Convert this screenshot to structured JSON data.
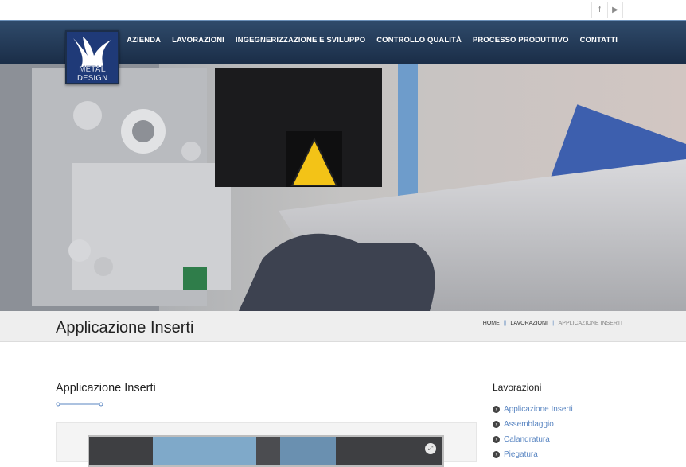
{
  "social": {
    "facebook_icon": "f",
    "youtube_icon": "▶"
  },
  "logo": {
    "line1": "METAL",
    "line2": "DESIGN"
  },
  "nav": [
    {
      "label": "AZIENDA"
    },
    {
      "label": "LAVORAZIONI"
    },
    {
      "label": "INGEGNERIZZAZIONE E SVILUPPO"
    },
    {
      "label": "CONTROLLO QUALITÀ"
    },
    {
      "label": "PROCESSO PRODUTTIVO"
    },
    {
      "label": "CONTATTI"
    }
  ],
  "page": {
    "title": "Applicazione Inserti"
  },
  "breadcrumb": {
    "home": "HOME",
    "sep": "||",
    "parent": "LAVORAZIONI",
    "current": "APPLICAZIONE INSERTI"
  },
  "content": {
    "title": "Applicazione Inserti"
  },
  "sidebar": {
    "title": "Lavorazioni",
    "items": [
      {
        "label": "Applicazione Inserti"
      },
      {
        "label": "Assemblaggio"
      },
      {
        "label": "Calandratura"
      },
      {
        "label": "Piegatura"
      }
    ]
  },
  "colors": {
    "nav_bg": "#1f3452",
    "link": "#5a86c2",
    "title_bar": "#eeeeee"
  }
}
